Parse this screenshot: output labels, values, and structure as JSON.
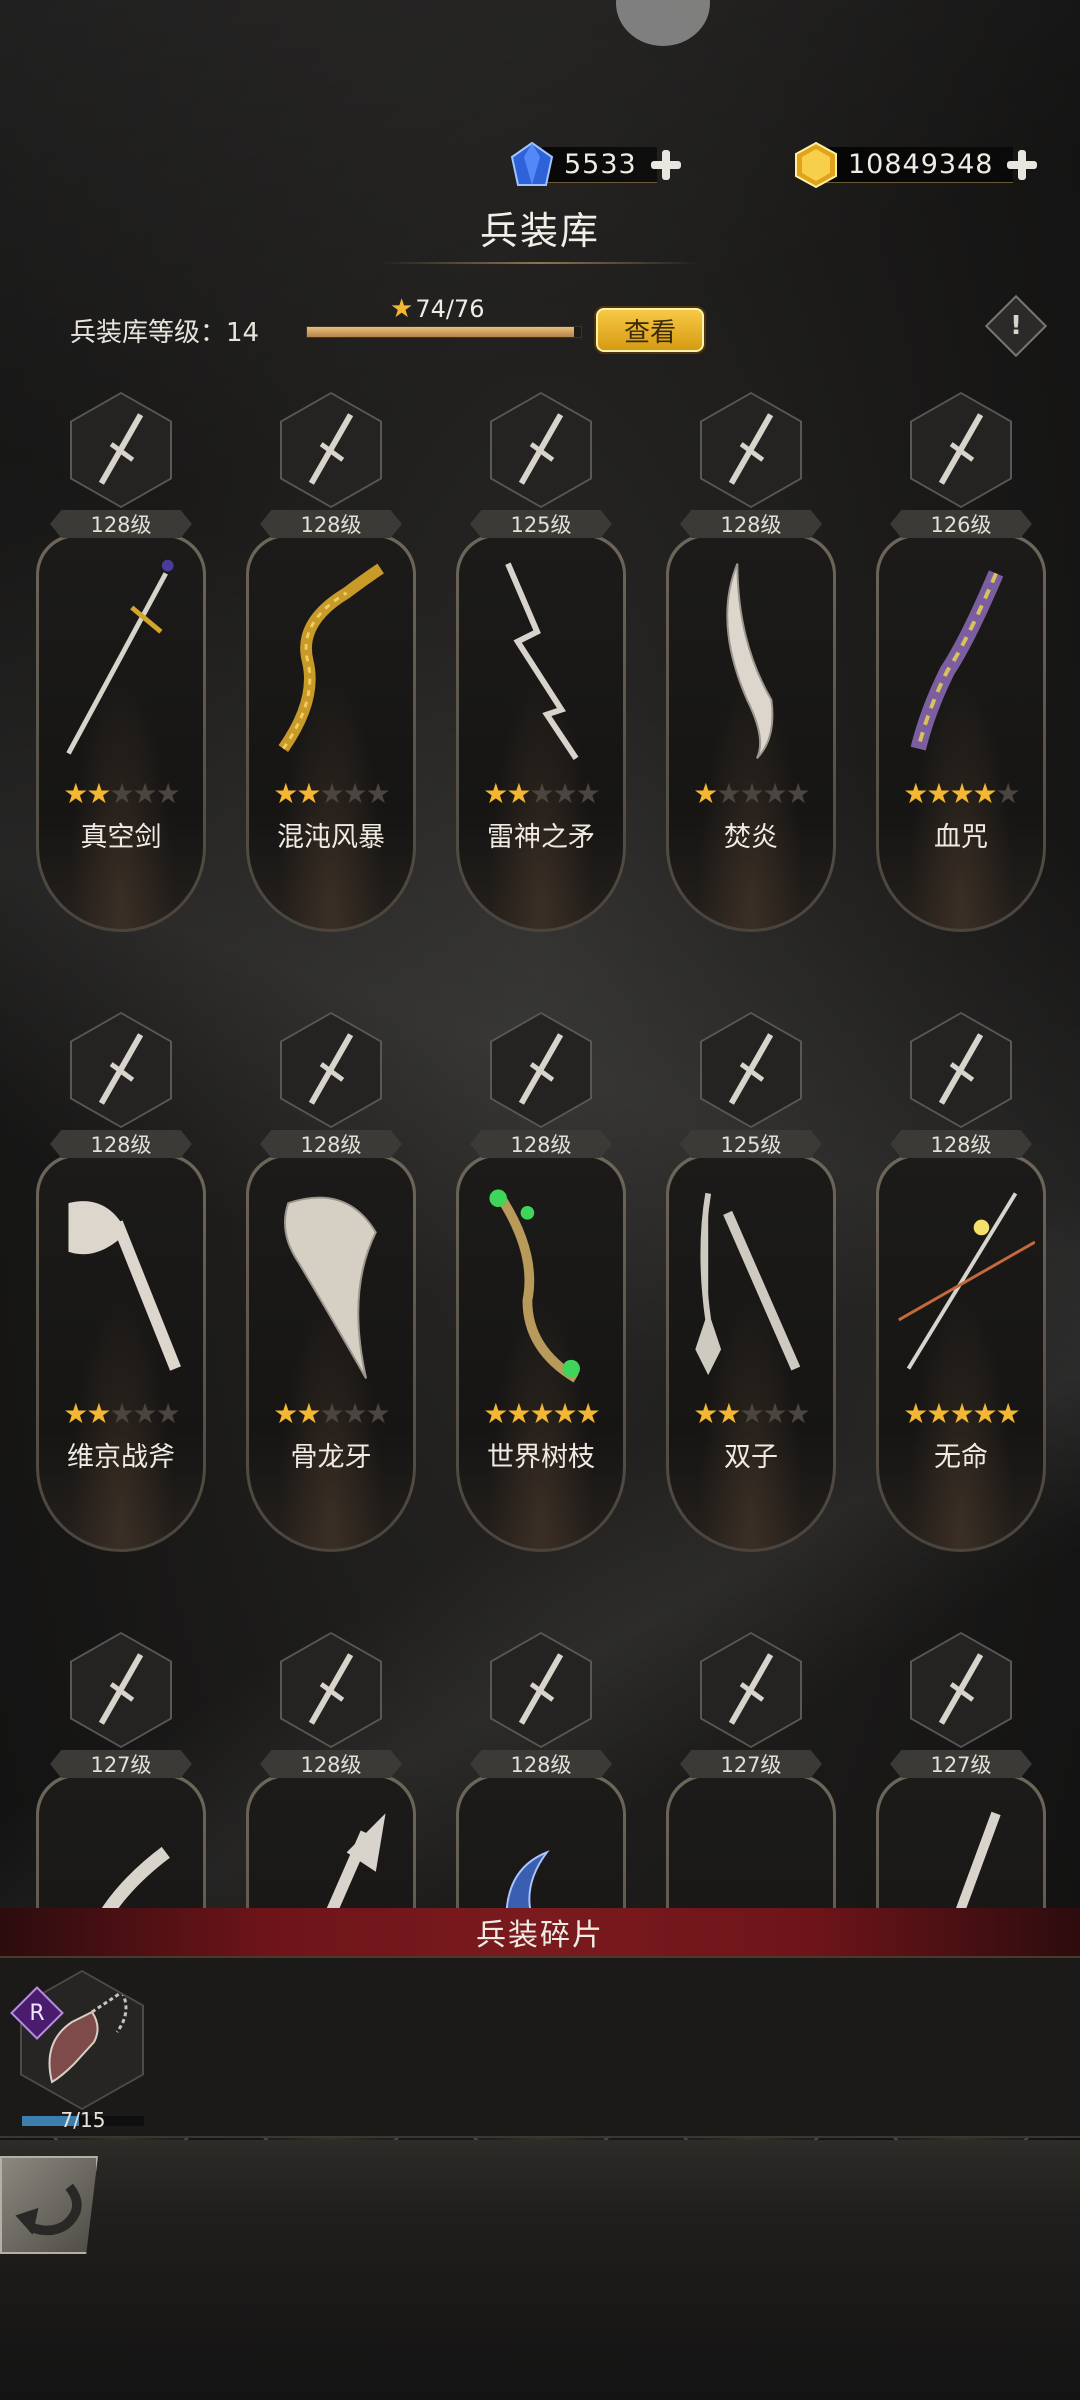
{
  "currency": {
    "gems": "5533",
    "gold": "10849348"
  },
  "title": "兵装库",
  "armory": {
    "level_label": "兵装库等级：14",
    "progress_text": "74/76",
    "progress_value": 74,
    "progress_max": 76,
    "view_button": "查看",
    "info_icon": "!"
  },
  "weapons": [
    {
      "level": "128级",
      "name": "真空剑",
      "stars": 2,
      "max_stars": 5
    },
    {
      "level": "128级",
      "name": "混沌风暴",
      "stars": 2,
      "max_stars": 5
    },
    {
      "level": "125级",
      "name": "雷神之矛",
      "stars": 2,
      "max_stars": 5
    },
    {
      "level": "128级",
      "name": "焚炎",
      "stars": 1,
      "max_stars": 5
    },
    {
      "level": "126级",
      "name": "血咒",
      "stars": 4,
      "max_stars": 5
    },
    {
      "level": "128级",
      "name": "维京战斧",
      "stars": 2,
      "max_stars": 5
    },
    {
      "level": "128级",
      "name": "骨龙牙",
      "stars": 2,
      "max_stars": 5
    },
    {
      "level": "128级",
      "name": "世界树枝",
      "stars": 5,
      "max_stars": 5
    },
    {
      "level": "125级",
      "name": "双子",
      "stars": 2,
      "max_stars": 5
    },
    {
      "level": "128级",
      "name": "无命",
      "stars": 5,
      "max_stars": 5
    },
    {
      "level": "127级",
      "name": "",
      "stars": 0,
      "max_stars": 5
    },
    {
      "level": "128级",
      "name": "",
      "stars": 0,
      "max_stars": 5
    },
    {
      "level": "128级",
      "name": "",
      "stars": 0,
      "max_stars": 5
    },
    {
      "level": "127级",
      "name": "",
      "stars": 0,
      "max_stars": 5
    },
    {
      "level": "127级",
      "name": "",
      "stars": 0,
      "max_stars": 5
    }
  ],
  "fragments": {
    "header": "兵装碎片",
    "items": [
      {
        "rarity": "R",
        "progress": "7/15",
        "current": 7,
        "required": 15
      }
    ]
  },
  "colors": {
    "star": "#f4b733",
    "gold_button": "#f8c945",
    "fragment_header": "#7a1a1e",
    "rarity_purple": "#4a1c6e"
  }
}
